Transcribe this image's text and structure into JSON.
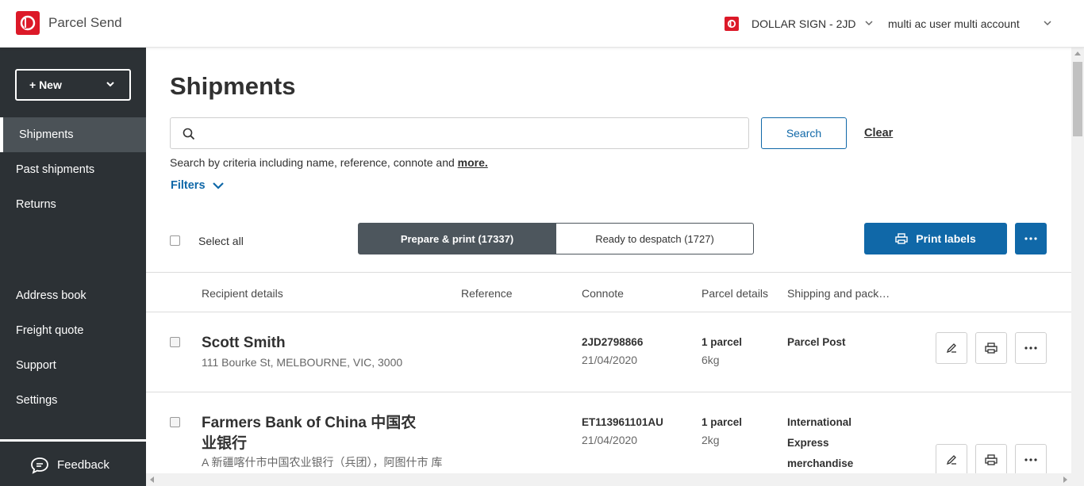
{
  "app": {
    "title": "Parcel Send"
  },
  "header": {
    "account": "DOLLAR SIGN - 2JD",
    "user": "multi ac user multi account"
  },
  "sidebar": {
    "new_label": "+ New",
    "items": [
      {
        "label": "Shipments"
      },
      {
        "label": "Past shipments"
      },
      {
        "label": "Returns"
      },
      {
        "label": "Address book"
      },
      {
        "label": "Freight quote"
      },
      {
        "label": "Support"
      },
      {
        "label": "Settings"
      }
    ],
    "feedback": "Feedback"
  },
  "main": {
    "title": "Shipments",
    "search": {
      "placeholder": "",
      "button": "Search",
      "clear": "Clear",
      "help": "Search by criteria including name, reference, connote and ",
      "help_more": "more."
    },
    "filters": "Filters",
    "select_all": "Select all",
    "tabs": [
      {
        "label": "Prepare & print (17337)"
      },
      {
        "label": "Ready to despatch (1727)"
      }
    ],
    "print_labels": "Print labels",
    "columns": [
      "Recipient details",
      "Reference",
      "Connote",
      "Parcel details",
      "Shipping and pack…"
    ],
    "rows": [
      {
        "name": "Scott Smith",
        "address": "111 Bourke St, MELBOURNE, VIC, 3000",
        "connote": "2JD2798866",
        "date": "21/04/2020",
        "parcels": "1 parcel",
        "weight": "6kg",
        "shipping": "Parcel Post"
      },
      {
        "name_line1": "Farmers Bank of China 中国农",
        "name_line2": "业银行",
        "address": "A 新疆喀什市中国农业银行（兵团），阿图什市 库",
        "connote": "ET113961101AU",
        "date": "21/04/2020",
        "parcels": "1 parcel",
        "weight": "2kg",
        "shipping_lines": [
          "International",
          "Express",
          "merchandise"
        ]
      }
    ]
  },
  "colors": {
    "brand_red": "#dc1928",
    "primary_blue": "#1068a8",
    "sidebar_bg": "#2c3135"
  }
}
